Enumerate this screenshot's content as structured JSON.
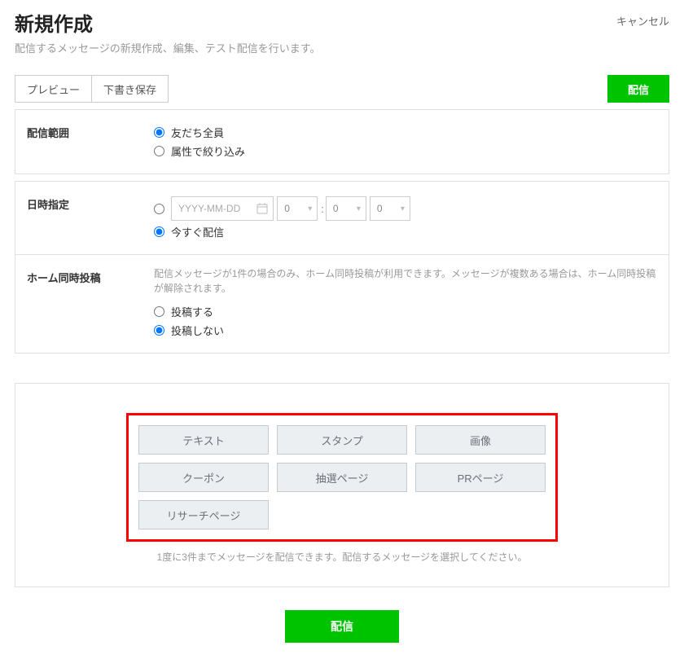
{
  "header": {
    "title": "新規作成",
    "subtitle": "配信するメッセージの新規作成、編集、テスト配信を行います。",
    "cancel": "キャンセル"
  },
  "toolbar": {
    "preview": "プレビュー",
    "save_draft": "下書き保存",
    "send": "配信"
  },
  "scope": {
    "label": "配信範囲",
    "opt_all": "友だち全員",
    "opt_filter": "属性で絞り込み"
  },
  "datetime": {
    "label": "日時指定",
    "placeholder": "YYYY-MM-DD",
    "hour": "0",
    "min1": "0",
    "min2": "0",
    "opt_now": "今すぐ配信"
  },
  "homepost": {
    "label": "ホーム同時投稿",
    "help": "配信メッセージが1件の場合のみ、ホーム同時投稿が利用できます。メッセージが複数ある場合は、ホーム同時投稿が解除されます。",
    "opt_post": "投稿する",
    "opt_nopost": "投稿しない"
  },
  "msgtypes": {
    "items": [
      "テキスト",
      "スタンプ",
      "画像",
      "クーポン",
      "抽選ページ",
      "PRページ",
      "リサーチページ"
    ],
    "helper": "1度に3件までメッセージを配信できます。配信するメッセージを選択してください。"
  },
  "footer": {
    "send": "配信"
  }
}
